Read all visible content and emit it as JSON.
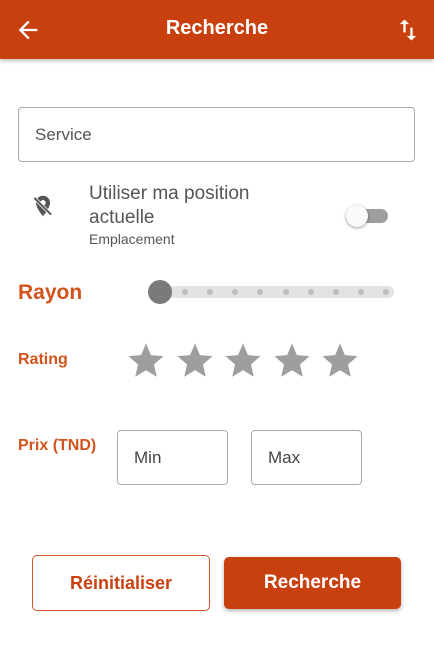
{
  "colors": {
    "primary": "#c9400f",
    "label": "#d2531b",
    "star": "#9e9e9e",
    "border": "#a9a9a9"
  },
  "appbar": {
    "title": "Recherche",
    "back_icon": "arrow-left-icon",
    "sort_icon": "swap-vertical-icon"
  },
  "service": {
    "placeholder": "Service",
    "value": ""
  },
  "location": {
    "icon": "location-off-icon",
    "title": "Utiliser ma position actuelle",
    "subtitle": "Emplacement",
    "enabled": false
  },
  "radius": {
    "label": "Rayon",
    "value": 0,
    "steps": 10
  },
  "rating": {
    "label": "Rating",
    "max": 5,
    "selected": 0
  },
  "price": {
    "label": "Prix (TND)",
    "min_placeholder": "Min",
    "max_placeholder": "Max"
  },
  "actions": {
    "reset_label": "Réinitialiser",
    "search_label": "Recherche"
  }
}
